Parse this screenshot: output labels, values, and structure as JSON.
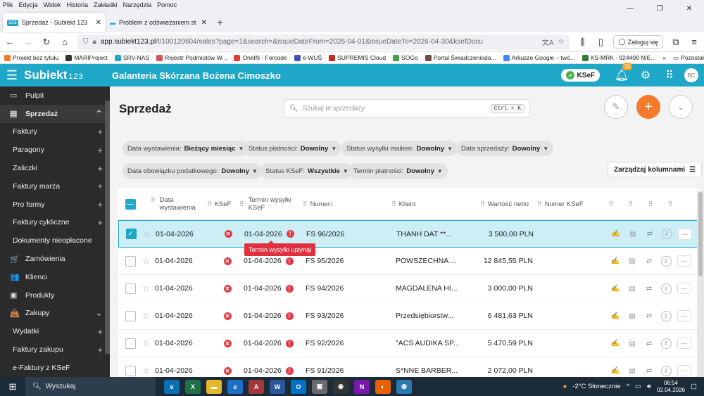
{
  "browser": {
    "menu": [
      "Plik",
      "Edycja",
      "Widok",
      "Historia",
      "Zakładki",
      "Narzędzia",
      "Pomoc"
    ],
    "tabs": [
      {
        "title": "Sprzedaż - Subiekt 123",
        "active": true
      },
      {
        "title": "Problem z odświeżaniem statusu",
        "active": false
      }
    ],
    "url_host": "app.subiekt123.pl",
    "url_rest": "/t/100120604/sales?page=1&search=&issueDateFrom=2026-04-01&issueDateTo=2026-04-30&ksefDocu",
    "login_label": "Zaloguj się",
    "bookmarks": [
      "Projekt bez tytułu",
      "MARIProject",
      "SRV-NAS",
      "Rejestr Podmiotów W...",
      "OneIN - Forcode",
      "e-WUŚ",
      "SUPREMIS Cloud",
      "SOGo",
      "Portal Świadczenioda...",
      "Arkusze Google – twó...",
      "KS-MRK - 924409 NIE..."
    ],
    "other_bookmarks": "Pozostałe zakładki"
  },
  "app": {
    "logo": "Subiekt",
    "logo_sup": "123",
    "company": "Galanteria Skórzana Bożena Cimoszko",
    "ksef_label": "KSeF",
    "notif_count": "11",
    "avatar": "BC"
  },
  "sidebar": {
    "items": [
      {
        "label": "Pulpit",
        "top": true,
        "icon": "▭"
      },
      {
        "label": "Sprzedaż",
        "top": true,
        "icon": "▤",
        "selected": true
      },
      {
        "label": "Faktury"
      },
      {
        "label": "Paragony"
      },
      {
        "label": "Zaliczki"
      },
      {
        "label": "Faktury marża"
      },
      {
        "label": "Pro formy"
      },
      {
        "label": "Faktury cykliczne"
      },
      {
        "label": "Dokumenty nieopłacone"
      },
      {
        "label": "Zamówienia",
        "top": true,
        "icon": "🛒"
      },
      {
        "label": "Klienci",
        "top": true,
        "icon": "👥"
      },
      {
        "label": "Produkty",
        "top": true,
        "icon": "▣"
      },
      {
        "label": "Zakupy",
        "top": true,
        "icon": "👜"
      },
      {
        "label": "Wydatki"
      },
      {
        "label": "Faktury zakupu"
      },
      {
        "label": "e-Faktury z KSeF"
      }
    ]
  },
  "main": {
    "title": "Sprzedaż",
    "search_placeholder": "Szukaj w sprzedaży",
    "search_shortcut": "Ctrl + K",
    "filters": [
      {
        "label": "Data wystawienia:",
        "value": "Bieżący miesiąc"
      },
      {
        "label": "Status płatności:",
        "value": "Dowolny"
      },
      {
        "label": "Status wysyłki mailem:",
        "value": "Dowolny"
      },
      {
        "label": "Data sprzedaży:",
        "value": "Dowolny"
      },
      {
        "label": "Data obowiązku podatkowego:",
        "value": "Dowolny"
      },
      {
        "label": "Status KSeF:",
        "value": "Wszystkie"
      },
      {
        "label": "Termin płatności:",
        "value": "Dowolny"
      }
    ],
    "manage_columns": "Zarządzaj kolumnami",
    "columns": {
      "date": "Data wystawienia",
      "ksef": "KSeF",
      "term": "Termin wysyłki KSeF",
      "num": "Numer",
      "client": "Klient",
      "val": "Wartość netto",
      "nksef": "Numer KSeF"
    },
    "tooltip": "Termin wysyłki upłynął",
    "rows": [
      {
        "date": "01-04-2026",
        "term": "01-04-2026",
        "num": "FS 96/2026",
        "client": "THANH DAT **...",
        "val": "3 500,00 PLN",
        "selected": true
      },
      {
        "date": "01-04-2026",
        "term": "01-04-2026",
        "num": "FS 95/2026",
        "client": "POWSZECHNA ...",
        "val": "12 845,55 PLN"
      },
      {
        "date": "01-04-2026",
        "term": "01-04-2026",
        "num": "FS 94/2026",
        "client": "MAGDALENA HI...",
        "val": "3 000,00 PLN"
      },
      {
        "date": "01-04-2026",
        "term": "01-04-2026",
        "num": "FS 93/2026",
        "client": "Przedsiębiorstw...",
        "val": "6 481,63 PLN"
      },
      {
        "date": "01-04-2026",
        "term": "01-04-2026",
        "num": "FS 92/2026",
        "client": "\"ACS AUDIKA SP...",
        "val": "5 470,59 PLN"
      },
      {
        "date": "01-04-2026",
        "term": "01-04-2026",
        "num": "FS 91/2026",
        "client": "S*NNE BARBER...",
        "val": "2 072,00 PLN"
      }
    ]
  },
  "taskbar": {
    "search": "Wyszukaj",
    "weather": "-2°C Słonecznie",
    "time": "06:54",
    "date": "02.04.2026"
  }
}
